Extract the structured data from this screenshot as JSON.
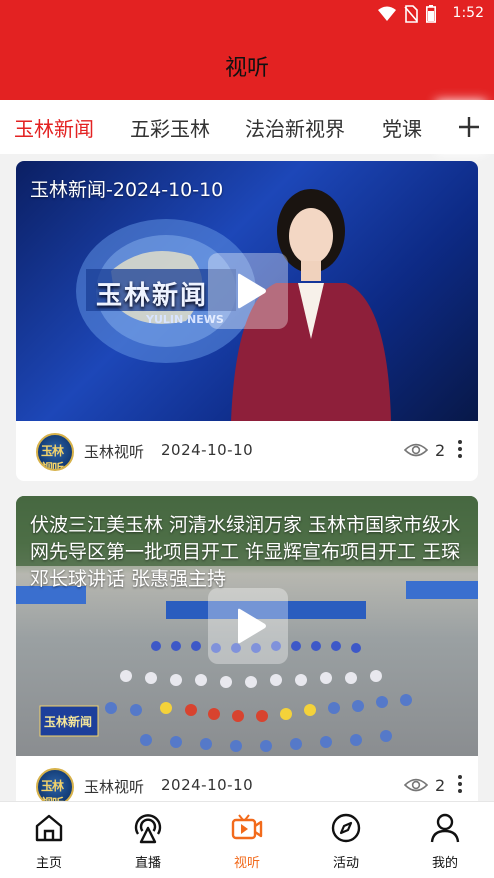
{
  "status_bar": {
    "time": "1:52"
  },
  "header": {
    "title": "视听"
  },
  "tabs": [
    {
      "label": "玉林新闻",
      "active": true
    },
    {
      "label": "五彩玉林",
      "active": false
    },
    {
      "label": "法治新视界",
      "active": false
    },
    {
      "label": "党课",
      "active": false
    }
  ],
  "cards": [
    {
      "title": "玉林新闻-2024-10-10",
      "thumbnail_caption": "玉林新闻",
      "thumbnail_caption_en": "YULIN NEWS",
      "source": "玉林视听",
      "date": "2024-10-10",
      "views": "2"
    },
    {
      "title": "伏波三江美玉林 河清水绿润万家 玉林市国家市级水网先导区第一批项目开工 许显辉宣布项目开工 王琛邓长球讲话 张惠强主持",
      "thumbnail_caption": "玉林新闻",
      "source": "玉林视听",
      "date": "2024-10-10",
      "views": "2"
    }
  ],
  "avatar_text": "玉林视听",
  "bottom_nav": [
    {
      "label": "主页",
      "icon": "home-icon",
      "active": false
    },
    {
      "label": "直播",
      "icon": "live-broadcast-icon",
      "active": false
    },
    {
      "label": "视听",
      "icon": "tv-play-icon",
      "active": true
    },
    {
      "label": "活动",
      "icon": "compass-icon",
      "active": false
    },
    {
      "label": "我的",
      "icon": "user-icon",
      "active": false
    }
  ],
  "colors": {
    "brand_red": "#e32222",
    "active_nav": "#f26a1b",
    "text": "#333333"
  }
}
